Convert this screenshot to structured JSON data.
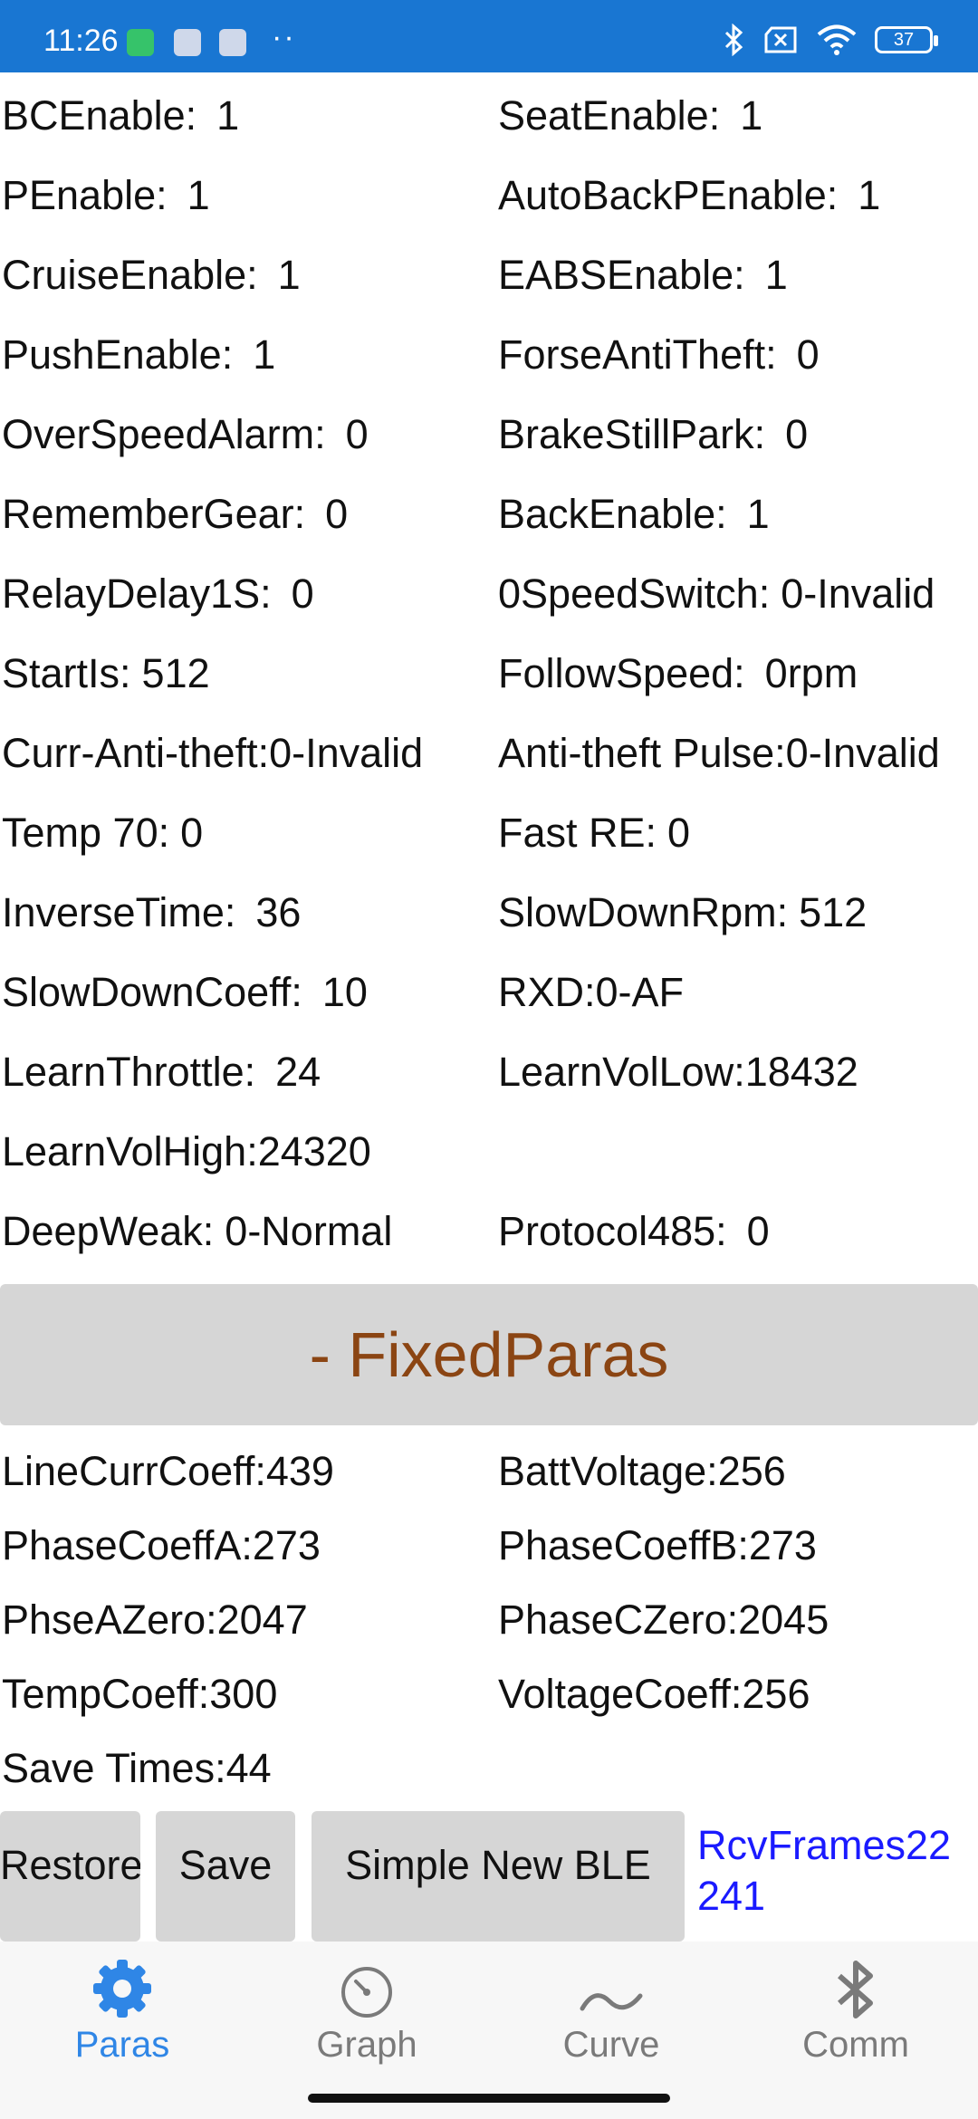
{
  "status_bar": {
    "time": "11:26",
    "dots": "··",
    "battery": "37",
    "icons": [
      "app-icon",
      "notification-icon",
      "notification-icon",
      "bluetooth-icon",
      "sim-off-icon",
      "wifi-icon",
      "battery-icon"
    ]
  },
  "params": [
    {
      "l1": "BCEnable:",
      "v1": "1",
      "l2": "SeatEnable:",
      "v2": "1"
    },
    {
      "l1": "PEnable:",
      "v1": "1",
      "l2": "AutoBackPEnable:",
      "v2": "1"
    },
    {
      "l1": "CruiseEnable:",
      "v1": "1",
      "l2": "EABSEnable:",
      "v2": "1"
    },
    {
      "l1": "PushEnable:",
      "v1": "1",
      "l2": "ForseAntiTheft:",
      "v2": "0"
    },
    {
      "l1": "OverSpeedAlarm:",
      "v1": "0",
      "l2": "BrakeStillPark:",
      "v2": "0"
    },
    {
      "l1": "RememberGear:",
      "v1": "0",
      "l2": "BackEnable:",
      "v2": "1"
    },
    {
      "l1": "RelayDelay1S:",
      "v1": "0",
      "l2": "0SpeedSwitch:",
      "v2": "0-Invalid"
    },
    {
      "l1": "StartIs:",
      "v1": "512",
      "l2": "FollowSpeed:",
      "v2": "0rpm"
    },
    {
      "l1": "Curr-Anti-theft:",
      "v1": "0-Invalid",
      "l2": "Anti-theft Pulse:",
      "v2": "0-Invalid"
    },
    {
      "l1": "Temp 70:",
      "v1": "0",
      "l2": "Fast RE:",
      "v2": "0"
    },
    {
      "l1": "InverseTime:",
      "v1": "36",
      "l2": "SlowDownRpm:",
      "v2": "512"
    },
    {
      "l1": "SlowDownCoeff:",
      "v1": "10",
      "l2": "RXD:",
      "v2": "0-AF"
    },
    {
      "l1": "LearnThrottle:",
      "v1": "24",
      "l2": "LearnVolLow:",
      "v2": "18432"
    },
    {
      "l1": "LearnVolHigh:",
      "v1": "24320",
      "l2": "",
      "v2": ""
    },
    {
      "l1": "DeepWeak:",
      "v1": "0-Normal",
      "l2": "Protocol485:",
      "v2": "0"
    }
  ],
  "section_title": "- FixedParas",
  "fixed": [
    {
      "c1": "LineCurrCoeff:439",
      "c2": "BattVoltage:256"
    },
    {
      "c1": "PhaseCoeffA:273",
      "c2": "PhaseCoeffB:273"
    },
    {
      "c1": "PhseAZero:2047",
      "c2": "PhaseCZero:2045"
    },
    {
      "c1": "TempCoeff:300",
      "c2": "VoltageCoeff:256"
    },
    {
      "c1": "Save Times:44",
      "c2": ""
    }
  ],
  "buttons": {
    "restore": "Restore",
    "save": "Save",
    "simple": "Simple New BLE"
  },
  "rcv_frames": "RcvFrames22241",
  "nav": [
    {
      "label": "Paras",
      "icon": "gear-icon"
    },
    {
      "label": "Graph",
      "icon": "gauge-icon"
    },
    {
      "label": "Curve",
      "icon": "wave-icon"
    },
    {
      "label": "Comm",
      "icon": "bluetooth-icon"
    }
  ],
  "colors": {
    "status_bar": "#1976d2",
    "section_text": "#8b4513",
    "section_bg": "#d6d6d6",
    "active_nav": "#2f86e6",
    "rcv_text": "#1a1aff"
  }
}
